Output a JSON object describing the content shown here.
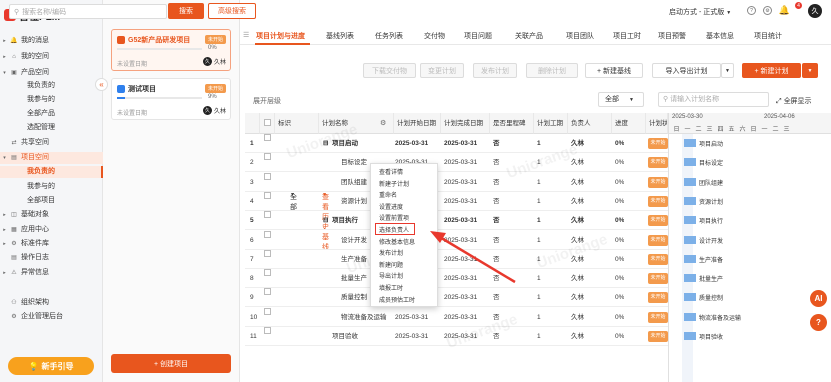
{
  "app": {
    "name": "智橙PLM"
  },
  "nav": {
    "items": [
      {
        "label": "我的消息",
        "icon": "bell-icon"
      },
      {
        "label": "我的空间",
        "icon": "home-icon"
      },
      {
        "label": "产品空间",
        "icon": "cube-icon"
      },
      {
        "label": "我负责的"
      },
      {
        "label": "我参与的"
      },
      {
        "label": "全部产品"
      },
      {
        "label": "选配管理"
      },
      {
        "label": "共享空间",
        "icon": "share-icon"
      },
      {
        "label": "项目空间",
        "icon": "project-icon"
      },
      {
        "label": "我负责的"
      },
      {
        "label": "我参与的"
      },
      {
        "label": "全部项目"
      },
      {
        "label": "基础对象",
        "icon": "object-icon"
      },
      {
        "label": "应用中心",
        "icon": "app-icon"
      },
      {
        "label": "标准件库",
        "icon": "library-icon"
      },
      {
        "label": "操作日志",
        "icon": "log-icon"
      },
      {
        "label": "异常信息",
        "icon": "warning-icon"
      },
      {
        "label": "组织架构",
        "icon": "org-icon"
      },
      {
        "label": "企业管理后台",
        "icon": "admin-icon"
      }
    ],
    "guide_label": "新手引导"
  },
  "search": {
    "placeholder": "搜索名称/编码",
    "button": "搜索",
    "advanced": "高级搜索"
  },
  "projects": [
    {
      "name": "G52新产品研发项目",
      "tag": "未开始",
      "progress_pct": 0,
      "progress_label": "0%",
      "date": "未设置日期",
      "owner": "久林",
      "owner_short": "久"
    },
    {
      "name": "测试项目",
      "tag": "未开始",
      "progress_pct": 9,
      "progress_label": "9%",
      "date": "未设置日期",
      "owner": "久林",
      "owner_short": "久"
    }
  ],
  "create_project": "+ 创建项目",
  "header": {
    "start_mode": "启动方式 - 正式版",
    "notif_count": "4",
    "user_short": "久"
  },
  "tabs": [
    "项目计划与进度",
    "基线列表",
    "任务列表",
    "交付物",
    "项目问题",
    "关联产品",
    "项目团队",
    "项目工时",
    "项目预警",
    "基本信息",
    "项目统计"
  ],
  "toolbar": {
    "deliverables": "下载交付物",
    "change": "变更计划",
    "publish": "发布计划",
    "delete": "删除计划",
    "new_baseline": "+ 新建基线",
    "import_export": "导入导出计划",
    "new_plan": "+ 新建计划"
  },
  "filter": {
    "expand_label": "展开层级",
    "expand_value": "全部",
    "history": "查看历史基线",
    "scope": "全部",
    "search_placeholder": "请输入计划名称",
    "fullscreen": "全屏显示"
  },
  "columns": [
    "标识",
    "计划名称",
    "计划开始日期",
    "计划完成日期",
    "是否里程碑",
    "计划工期",
    "负责人",
    "进度",
    "计划状"
  ],
  "rows": [
    {
      "no": "1",
      "name": "项目启动",
      "start": "2025-03-31",
      "end": "2025-03-31",
      "milestone": "否",
      "duration": "1",
      "owner": "久林",
      "progress": "0%",
      "status": "未开始",
      "bold": true,
      "group": true
    },
    {
      "no": "2",
      "name": "目标设定",
      "start": "2025-03-31",
      "end": "2025-03-31",
      "milestone": "否",
      "duration": "1",
      "owner": "久林",
      "progress": "0%",
      "status": "未开始"
    },
    {
      "no": "3",
      "name": "团队组建",
      "start": "2025-03-31",
      "end": "2025-03-31",
      "milestone": "否",
      "duration": "1",
      "owner": "久林",
      "progress": "0%",
      "status": "未开始"
    },
    {
      "no": "4",
      "name": "资源计划",
      "start": "2025-03-31",
      "end": "2025-03-31",
      "milestone": "否",
      "duration": "1",
      "owner": "久林",
      "progress": "0%",
      "status": "未开始"
    },
    {
      "no": "5",
      "name": "项目执行",
      "start": "2025-03-31",
      "end": "2025-03-31",
      "milestone": "否",
      "duration": "1",
      "owner": "久林",
      "progress": "0%",
      "status": "未开始",
      "bold": true,
      "group": true
    },
    {
      "no": "6",
      "name": "设计开发",
      "start": "2025-03-31",
      "end": "2025-03-31",
      "milestone": "否",
      "duration": "1",
      "owner": "久林",
      "progress": "0%",
      "status": "未开始"
    },
    {
      "no": "7",
      "name": "生产准备",
      "start": "2025-03-31",
      "end": "2025-03-31",
      "milestone": "否",
      "duration": "1",
      "owner": "久林",
      "progress": "0%",
      "status": "未开始"
    },
    {
      "no": "8",
      "name": "批量生产",
      "start": "2025-03-31",
      "end": "2025-03-31",
      "milestone": "否",
      "duration": "1",
      "owner": "久林",
      "progress": "0%",
      "status": "未开始"
    },
    {
      "no": "9",
      "name": "质量控制",
      "start": "2025-03-31",
      "end": "2025-03-31",
      "milestone": "否",
      "duration": "1",
      "owner": "久林",
      "progress": "0%",
      "status": "未开始"
    },
    {
      "no": "10",
      "name": "物流准备及运输",
      "start": "2025-03-31",
      "end": "2025-03-31",
      "milestone": "否",
      "duration": "1",
      "owner": "久林",
      "progress": "0%",
      "status": "未开始"
    },
    {
      "no": "11",
      "name": "项目验收",
      "start": "2025-03-31",
      "end": "2025-03-31",
      "milestone": "否",
      "duration": "1",
      "owner": "久林",
      "progress": "0%",
      "status": "未开始"
    }
  ],
  "gantt": {
    "week1": "2025-03-30",
    "week2": "2025-04-06",
    "days": [
      "日",
      "一",
      "二",
      "三",
      "四",
      "五",
      "六",
      "日",
      "一",
      "二",
      "三"
    ],
    "labels": [
      "项目启动",
      "目标设定",
      "团队组建",
      "资源计划",
      "项目执行",
      "设计开发",
      "生产准备",
      "批量生产",
      "质量控制",
      "物流准备及运输",
      "项目验收"
    ]
  },
  "context_menu": [
    "查看详情",
    "新建子计划",
    "重命名",
    "设置进度",
    "设置前置项",
    "选择负责人",
    "修改基本信息",
    "发布计划",
    "新建问题",
    "导出计划",
    "填报工时",
    "成员预估工时"
  ],
  "watermark": "Uniorange",
  "fab": {
    "ai": "AI",
    "help": "?"
  },
  "colors": {
    "accent": "#e8561e",
    "status": "#f39a4c",
    "gantt_bar": "#7cb0e8",
    "highlight": "#e8382d"
  }
}
